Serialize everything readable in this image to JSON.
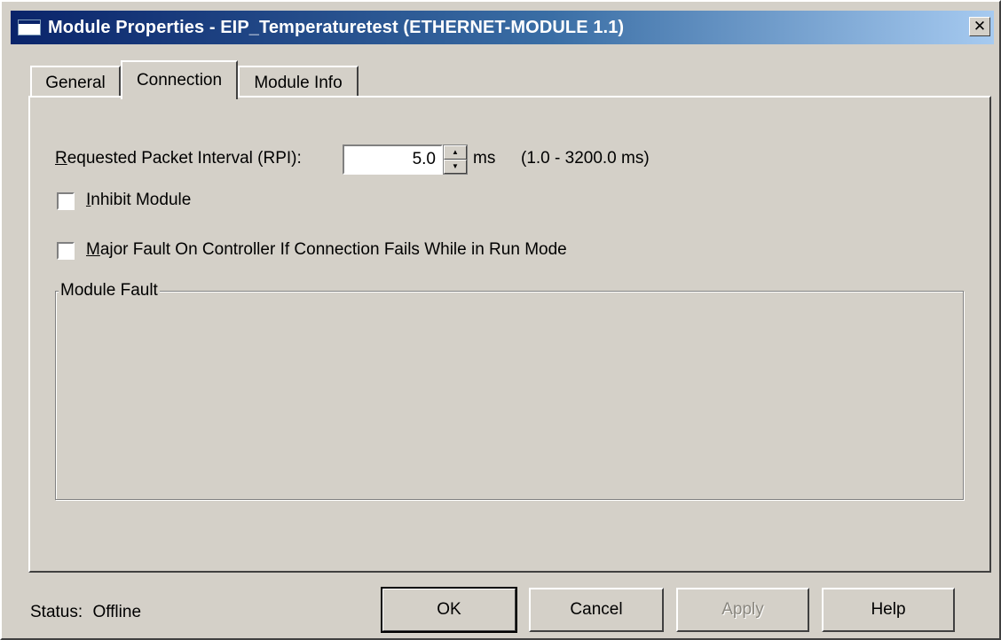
{
  "window": {
    "title": "Module Properties  - EIP_Temperaturetest (ETHERNET-MODULE 1.1)",
    "close_glyph": "✕"
  },
  "tabs": [
    {
      "label": "General",
      "active": false
    },
    {
      "label": "Connection",
      "active": true
    },
    {
      "label": "Module Info",
      "active": false
    }
  ],
  "connection": {
    "rpi_label_first": "R",
    "rpi_label_rest": "equested Packet Interval (RPI):",
    "rpi_value": "5.0",
    "rpi_unit": "ms",
    "rpi_range": "(1.0 - 3200.0 ms)",
    "inhibit_label_first": "I",
    "inhibit_label_rest": "nhibit Module",
    "inhibit_checked": false,
    "major_fault_label_first": "M",
    "major_fault_label_rest": "ajor Fault On Controller If Connection Fails While in Run Mode",
    "major_fault_checked": false,
    "module_fault_title": "Module Fault"
  },
  "footer": {
    "status_label": "Status:",
    "status_value": "Offline",
    "ok_label": "OK",
    "cancel_label": "Cancel",
    "apply_label": "Apply",
    "help_label": "Help"
  },
  "colors": {
    "title_gradient_start": "#0a246a",
    "title_gradient_end": "#a6caf0",
    "face": "#d4d0c8"
  }
}
